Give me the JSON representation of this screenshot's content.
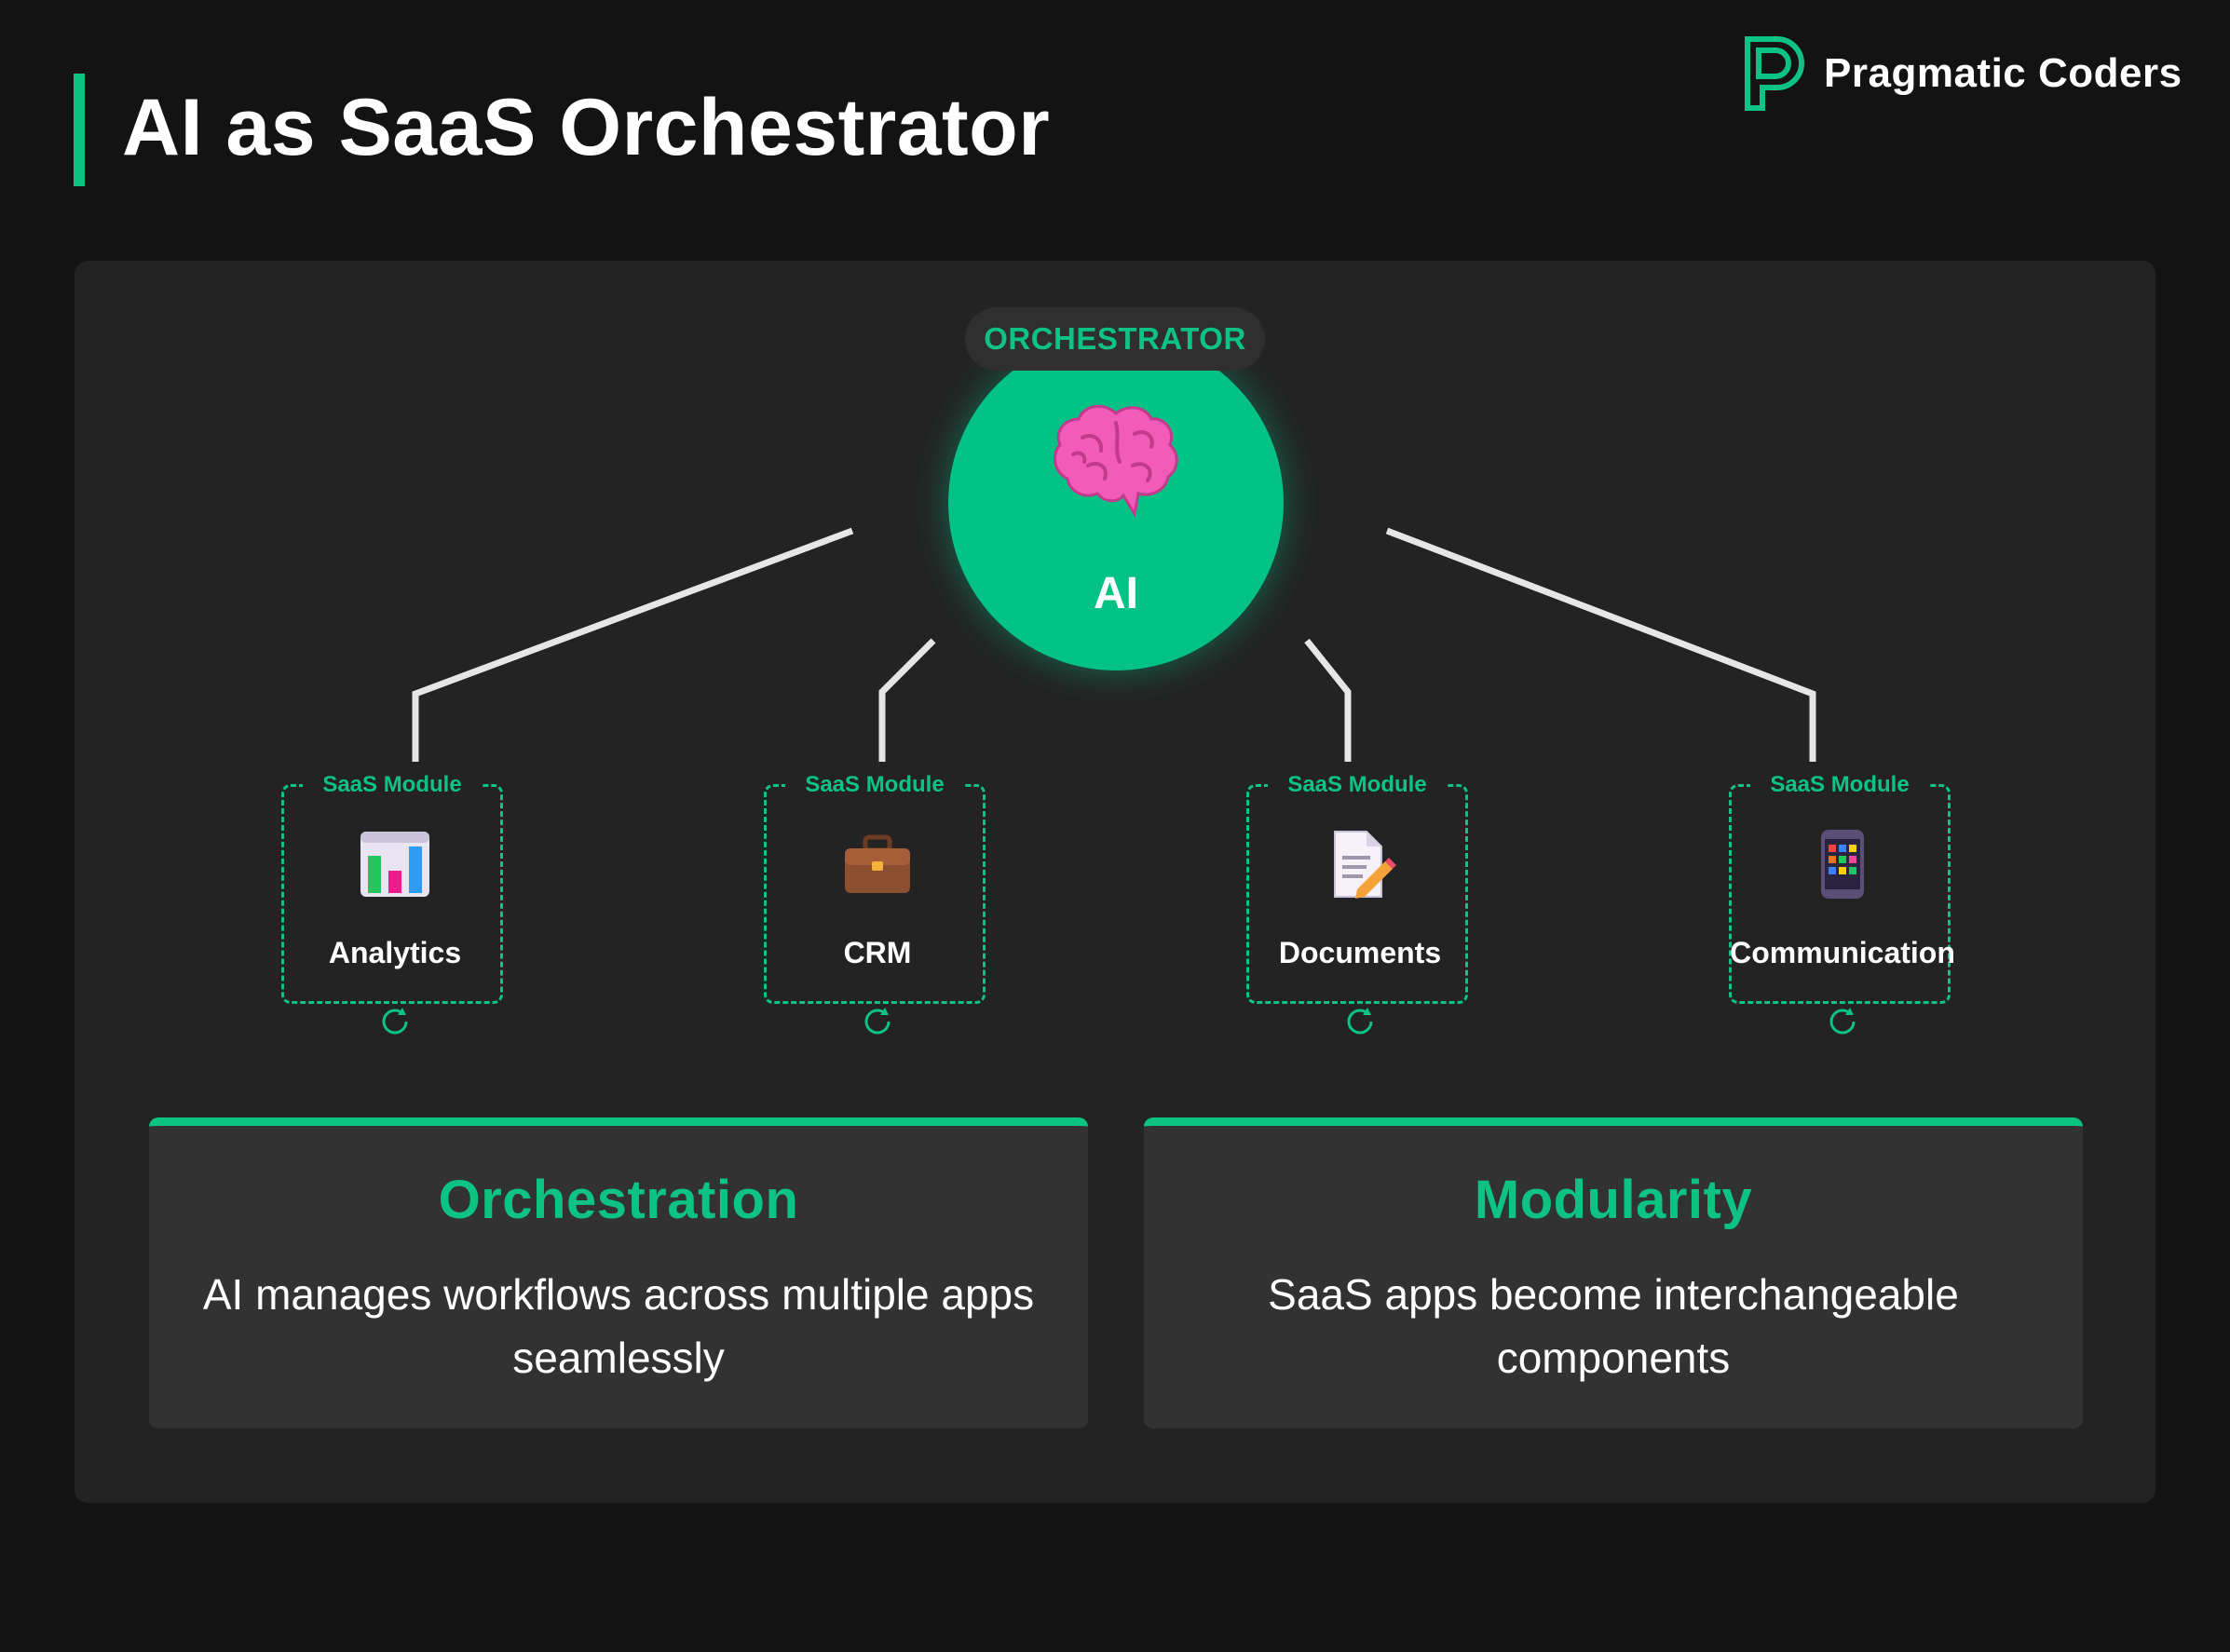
{
  "page": {
    "title": "AI as SaaS Orchestrator",
    "accent_color": "#0dc383"
  },
  "brand": {
    "name": "Pragmatic Coders",
    "logo_icon": "pragmatic-coders-logo-icon"
  },
  "orchestrator": {
    "badge": "ORCHESTRATOR",
    "label": "AI",
    "icon": "brain-icon",
    "color": "#03c285"
  },
  "modules": [
    {
      "tag": "SaaS Module",
      "label": "Analytics",
      "icon": "bar-chart-icon"
    },
    {
      "tag": "SaaS Module",
      "label": "CRM",
      "icon": "briefcase-icon"
    },
    {
      "tag": "SaaS Module",
      "label": "Documents",
      "icon": "document-pencil-icon"
    },
    {
      "tag": "SaaS Module",
      "label": "Communication",
      "icon": "phone-apps-icon"
    }
  ],
  "cards": [
    {
      "title": "Orchestration",
      "body": "AI manages workflows across multiple apps seamlessly"
    },
    {
      "title": "Modularity",
      "body": "SaaS apps become interchangeable components"
    }
  ]
}
